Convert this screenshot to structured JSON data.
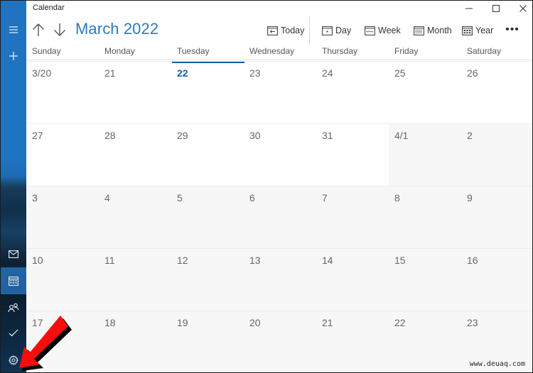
{
  "window": {
    "title": "Calendar",
    "controls": [
      "minimize",
      "maximize",
      "close"
    ]
  },
  "sidebar": {
    "top": [
      {
        "name": "menu",
        "icon": "hamburger-icon"
      },
      {
        "name": "new-event",
        "icon": "plus-icon"
      }
    ],
    "bottom": [
      {
        "name": "mail",
        "icon": "mail-icon"
      },
      {
        "name": "calendar",
        "icon": "calendar-icon",
        "active": true
      },
      {
        "name": "people",
        "icon": "people-icon"
      },
      {
        "name": "todo",
        "icon": "todo-icon"
      },
      {
        "name": "settings",
        "icon": "gear-icon"
      }
    ]
  },
  "header": {
    "month_title": "March 2022",
    "prev_icon": "arrow-up-icon",
    "next_icon": "arrow-down-icon"
  },
  "toolbar": {
    "today": "Today",
    "day": "Day",
    "week": "Week",
    "month": "Month",
    "year": "Year",
    "more": "•••"
  },
  "weekdays": [
    "Sunday",
    "Monday",
    "Tuesday",
    "Wednesday",
    "Thursday",
    "Friday",
    "Saturday"
  ],
  "weeks": [
    [
      {
        "label": "3/20"
      },
      {
        "label": "21"
      },
      {
        "label": "22",
        "today": true
      },
      {
        "label": "23"
      },
      {
        "label": "24"
      },
      {
        "label": "25"
      },
      {
        "label": "26"
      }
    ],
    [
      {
        "label": "27"
      },
      {
        "label": "28"
      },
      {
        "label": "29"
      },
      {
        "label": "30"
      },
      {
        "label": "31"
      },
      {
        "label": "4/1",
        "other": true
      },
      {
        "label": "2",
        "other": true
      }
    ],
    [
      {
        "label": "3",
        "other": true
      },
      {
        "label": "4",
        "other": true
      },
      {
        "label": "5",
        "other": true
      },
      {
        "label": "6",
        "other": true
      },
      {
        "label": "7",
        "other": true
      },
      {
        "label": "8",
        "other": true
      },
      {
        "label": "9",
        "other": true
      }
    ],
    [
      {
        "label": "10",
        "other": true
      },
      {
        "label": "11",
        "other": true
      },
      {
        "label": "12",
        "other": true
      },
      {
        "label": "13",
        "other": true
      },
      {
        "label": "14",
        "other": true
      },
      {
        "label": "15",
        "other": true
      },
      {
        "label": "16",
        "other": true
      }
    ],
    [
      {
        "label": "17",
        "other": true
      },
      {
        "label": "18",
        "other": true
      },
      {
        "label": "19",
        "other": true
      },
      {
        "label": "20",
        "other": true
      },
      {
        "label": "21",
        "other": true
      },
      {
        "label": "22",
        "other": true
      },
      {
        "label": "23",
        "other": true
      }
    ]
  ],
  "colors": {
    "accent": "#2a7ac4",
    "today": "#1460a8",
    "sidebar": "#1f73c1",
    "annotation_arrow": "#ff0000"
  },
  "watermark": "www.deuaq.com"
}
